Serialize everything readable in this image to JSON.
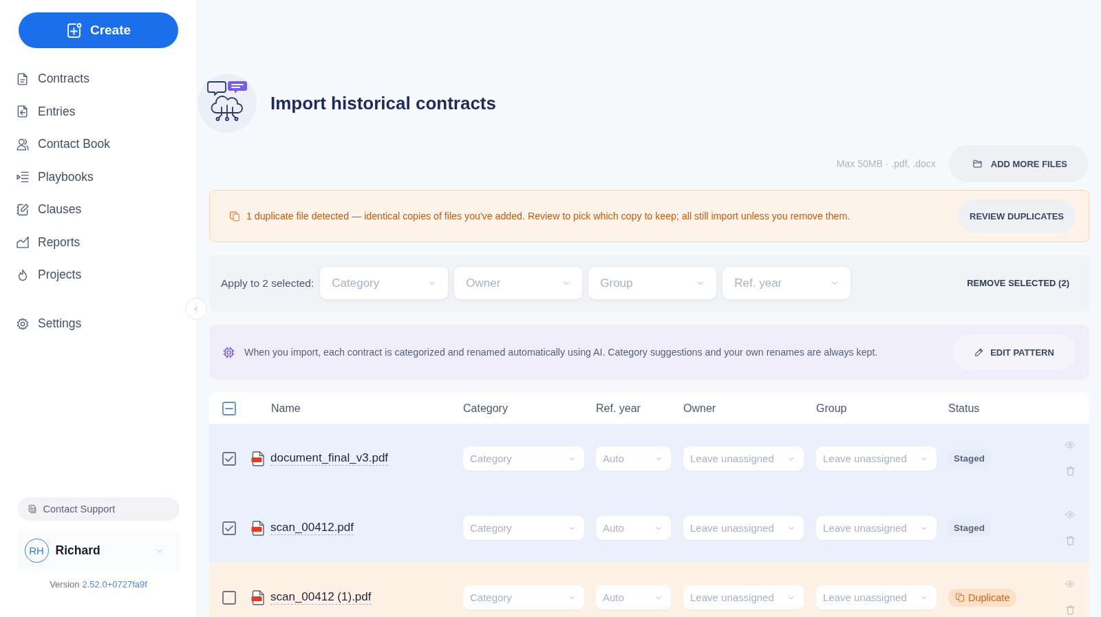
{
  "sidebar": {
    "create_button": "Create",
    "nav_items": [
      "Contracts",
      "Entries",
      "Contact Book",
      "Playbooks",
      "Clauses",
      "Reports",
      "Projects"
    ],
    "settings": "Settings",
    "support_button": "Contact Support",
    "user": {
      "initials": "RH",
      "name": "Richard"
    },
    "version": {
      "label": "Version",
      "number": "2.52.0+0727fa9f"
    }
  },
  "page": {
    "title": "Import historical contracts",
    "upload_hint": "Max 50MB · .pdf, .docx",
    "add_files_button": "ADD MORE FILES"
  },
  "duplicate_notice": {
    "message": "1 duplicate file detected — identical copies of files you've added. Review to pick which copy to keep; all still import unless you remove them.",
    "button": "REVIEW DUPLICATES"
  },
  "bulk_actions": {
    "label": "Apply to 2 selected:",
    "dropdowns": [
      {
        "placeholder": "Category"
      },
      {
        "placeholder": "Owner"
      },
      {
        "placeholder": "Group"
      },
      {
        "placeholder": "Ref. year"
      }
    ],
    "remove_button": "REMOVE SELECTED (2)"
  },
  "ai_notice": {
    "message": "When you import, each contract is categorized and renamed automatically using AI. Category suggestions and your own renames are always kept.",
    "button": "EDIT PATTERN"
  },
  "table": {
    "select_all": {
      "indeterminate": true
    },
    "columns": [
      "Name",
      "Category",
      "Ref. year",
      "Owner",
      "Group",
      "Status"
    ],
    "rows": [
      {
        "selected": true,
        "name": "document_final_v3.pdf",
        "category": {
          "placeholder": "Category"
        },
        "ref_year": {
          "placeholder": "Auto"
        },
        "owner": {
          "placeholder": "Leave unassigned"
        },
        "group": {
          "placeholder": "Leave unassigned"
        },
        "status": {
          "kind": "staged",
          "label": "Staged"
        }
      },
      {
        "selected": true,
        "name": "scan_00412.pdf",
        "category": {
          "placeholder": "Category"
        },
        "ref_year": {
          "placeholder": "Auto"
        },
        "owner": {
          "placeholder": "Leave unassigned"
        },
        "group": {
          "placeholder": "Leave unassigned"
        },
        "status": {
          "kind": "staged",
          "label": "Staged"
        }
      },
      {
        "selected": false,
        "name": "scan_00412 (1).pdf",
        "category": {
          "placeholder": "Category"
        },
        "ref_year": {
          "placeholder": "Auto"
        },
        "owner": {
          "placeholder": "Leave unassigned"
        },
        "group": {
          "placeholder": "Leave unassigned"
        },
        "status": {
          "kind": "duplicate",
          "label": "Duplicate"
        }
      }
    ]
  }
}
